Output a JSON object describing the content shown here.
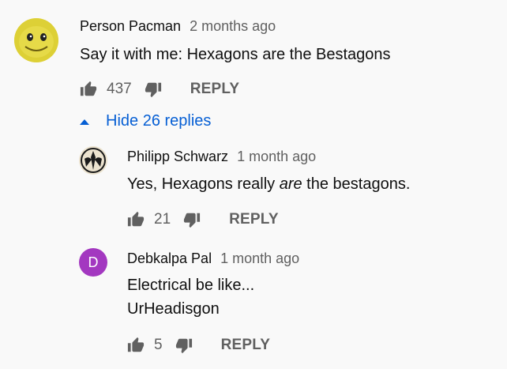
{
  "comments": [
    {
      "author": "Person Pacman",
      "time": "2 months ago",
      "lines": [
        "Say it with me: Hexagons are the Bestagons"
      ],
      "likes": "437",
      "reply_label": "REPLY",
      "avatar_icon": "pacman-face-avatar"
    }
  ],
  "replies_toggle": {
    "label": "Hide 26 replies"
  },
  "replies": [
    {
      "author": "Philipp Schwarz",
      "time": "1 month ago",
      "text_before": "Yes, Hexagons really ",
      "text_em": "are",
      "text_after": " the bestagons.",
      "likes": "21",
      "reply_label": "REPLY",
      "avatar_icon": "emblem-avatar"
    },
    {
      "author": "Debkalpa Pal",
      "time": "1 month ago",
      "lines": [
        "Electrical be like...",
        "UrHeadisgon"
      ],
      "likes": "5",
      "reply_label": "REPLY",
      "avatar_letter": "D",
      "avatar_color": "#a338c0"
    }
  ],
  "colors": {
    "link_blue": "#065fd4",
    "muted": "#606060",
    "background": "#f9f9f9"
  }
}
